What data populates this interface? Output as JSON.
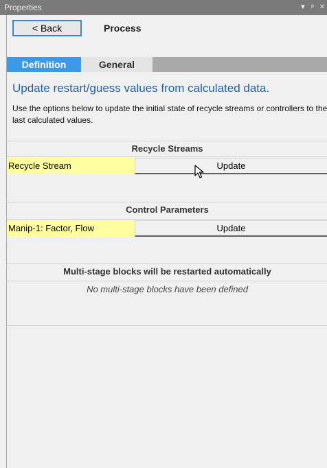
{
  "window": {
    "title": "Properties",
    "icons": [
      "dropdown-arrow-icon",
      "pin-icon",
      "close-icon"
    ]
  },
  "header": {
    "back_label": "< Back",
    "title": "Process"
  },
  "tabs": [
    {
      "label": "Definition",
      "active": true
    },
    {
      "label": "General",
      "active": false
    }
  ],
  "intro": {
    "heading": "Update restart/guess values from calculated data.",
    "description": "Use the options below to update the initial state of recycle streams or controllers to the last calculated values."
  },
  "recycle_streams": {
    "title": "Recycle Streams",
    "rows": [
      {
        "label": "Recycle Stream",
        "button": "Update"
      }
    ]
  },
  "control_parameters": {
    "title": "Control Parameters",
    "rows": [
      {
        "label": "Manip-1: Factor, Flow",
        "button": "Update"
      }
    ]
  },
  "multistage": {
    "title": "Multi-stage blocks will be restarted automatically",
    "empty_note": "No multi-stage blocks have been defined"
  },
  "colors": {
    "accent": "#3b9ae8",
    "heading": "#1f5fa8",
    "highlight": "#ffff9f",
    "titlebar": "#7a7a7a"
  }
}
